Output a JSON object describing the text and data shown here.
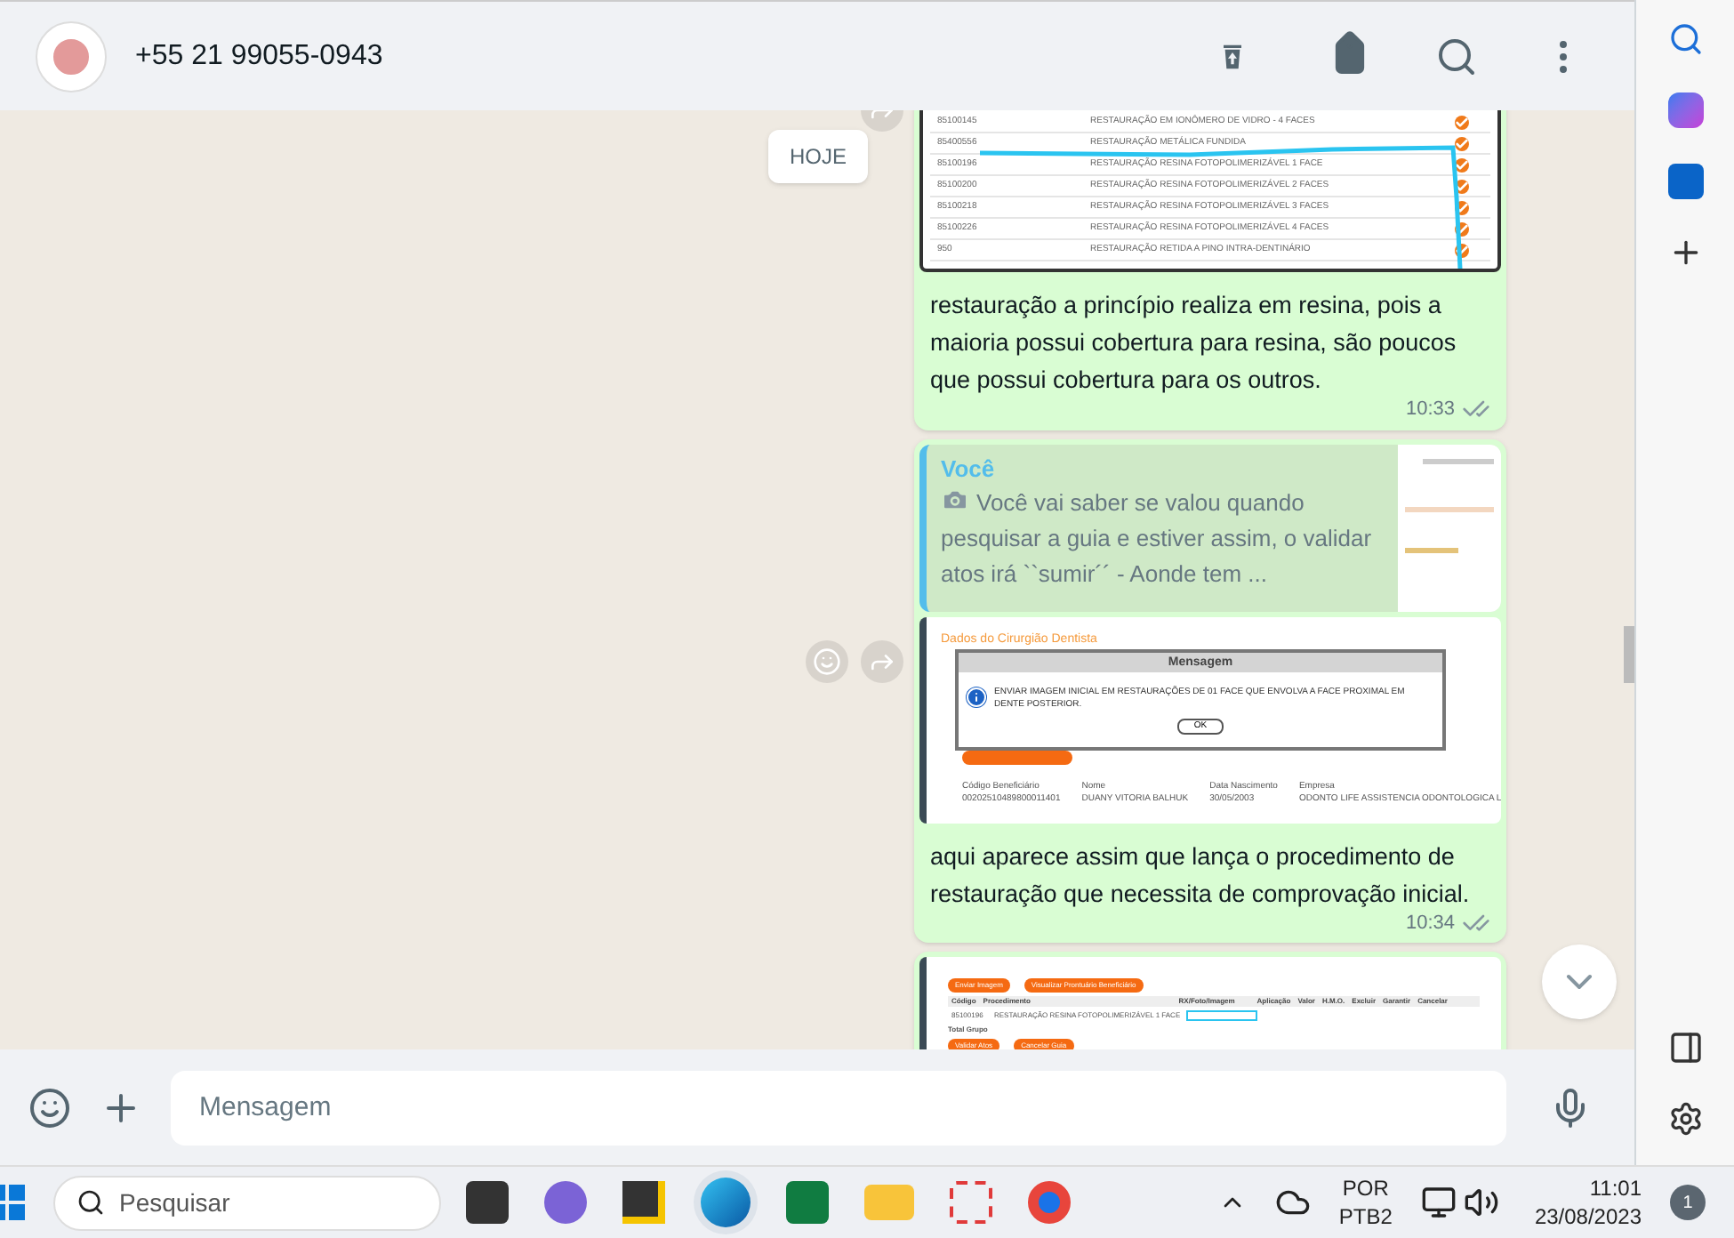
{
  "header": {
    "contact": "+55 21 99055-0943"
  },
  "date_chip": "HOJE",
  "messages": [
    {
      "image": {
        "kind": "table",
        "rows": [
          {
            "code": "85100145",
            "procedure": "RESTAURAÇÃO EM IONÔMERO DE VIDRO - 4 FACES"
          },
          {
            "code": "85400556",
            "procedure": "RESTAURAÇÃO METÁLICA FUNDIDA"
          },
          {
            "code": "85100196",
            "procedure": "RESTAURAÇÃO RESINA FOTOPOLIMERIZÁVEL 1 FACE"
          },
          {
            "code": "85100200",
            "procedure": "RESTAURAÇÃO RESINA FOTOPOLIMERIZÁVEL 2 FACES"
          },
          {
            "code": "85100218",
            "procedure": "RESTAURAÇÃO RESINA FOTOPOLIMERIZÁVEL 3 FACES"
          },
          {
            "code": "85100226",
            "procedure": "RESTAURAÇÃO RESINA FOTOPOLIMERIZÁVEL 4 FACES"
          },
          {
            "code": "950",
            "procedure": "RESTAURAÇÃO RETIDA A PINO INTRA-DENTINÁRIO"
          }
        ]
      },
      "text": "restauração a princípio realiza em resina, pois a maioria possui cobertura para resina, são poucos que possui cobertura para os outros.",
      "time": "10:33",
      "read": false
    },
    {
      "quote": {
        "author": "Você",
        "text": "Você vai saber se valou quando pesquisar a guia e estiver assim, o validar atos irá ``sumir´´ - Aonde tem ..."
      },
      "image": {
        "kind": "dialog",
        "section": "Dados do Cirurgião Dentista",
        "dialog_title": "Mensagem",
        "dialog_text": "ENVIAR IMAGEM INICIAL EM RESTAURAÇÕES DE 01 FACE QUE ENVOLVA A FACE PROXIMAL EM DENTE POSTERIOR.",
        "dialog_button": "OK",
        "fields": [
          {
            "label": "Código Beneficiário",
            "value": "00202510489800011401"
          },
          {
            "label": "Nome",
            "value": "DUANY VITORIA BALHUK"
          },
          {
            "label": "Data Nascimento",
            "value": "30/05/2003"
          },
          {
            "label": "Empresa",
            "value": "ODONTO LIFE ASSISTENCIA ODONTOLOGICA L"
          }
        ]
      },
      "text": "aqui aparece assim que lança o procedimento de restauração que necessita de comprovação inicial.",
      "time": "10:34",
      "read": false
    },
    {
      "image": {
        "kind": "form",
        "top_buttons": [
          "Enviar Imagem",
          "Visualizar Prontuário Beneficiário"
        ],
        "columns": [
          "Código",
          "Procedimento",
          "RX/Foto/Imagem",
          "Aplicação",
          "Valor",
          "H.M.O.",
          "Excluir",
          "Garantir",
          "Cancelar"
        ],
        "row": {
          "code": "85100196",
          "procedure": "RESTAURAÇÃO RESINA FOTOPOLIMERIZÁVEL 1 FACE"
        },
        "total": "Total Grupo",
        "bottom_buttons": [
          "Validar Atos",
          "Cancelar Guia"
        ]
      }
    }
  ],
  "composer": {
    "placeholder": "Mensagem"
  },
  "taskbar": {
    "search_placeholder": "Pesquisar",
    "language": "POR",
    "layout": "PTB2",
    "time": "11:01",
    "date": "23/08/2023",
    "notifications": "1"
  }
}
